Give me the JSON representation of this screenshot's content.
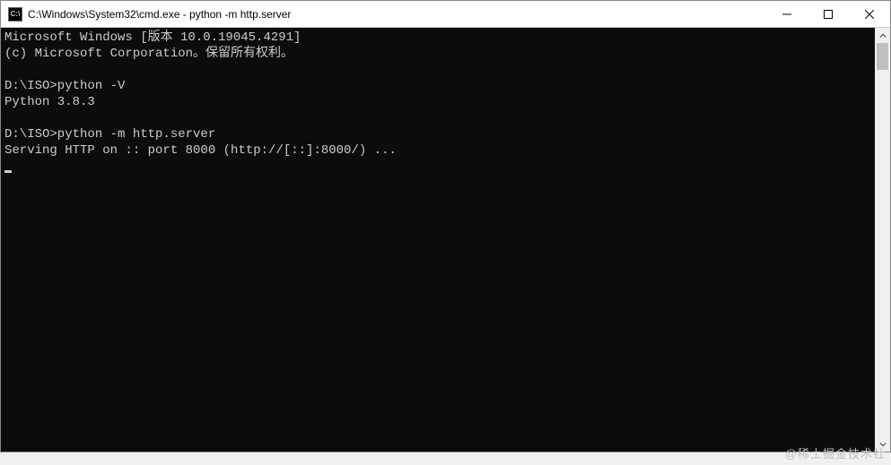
{
  "window": {
    "icon_label": "C:\\",
    "title": "C:\\Windows\\System32\\cmd.exe - python  -m http.server"
  },
  "terminal": {
    "lines": [
      "Microsoft Windows [版本 10.0.19045.4291]",
      "(c) Microsoft Corporation。保留所有权利。",
      "",
      "D:\\ISO>python -V",
      "Python 3.8.3",
      "",
      "D:\\ISO>python -m http.server",
      "Serving HTTP on :: port 8000 (http://[::]:8000/) ..."
    ]
  },
  "watermark": "@稀土掘金技术社"
}
